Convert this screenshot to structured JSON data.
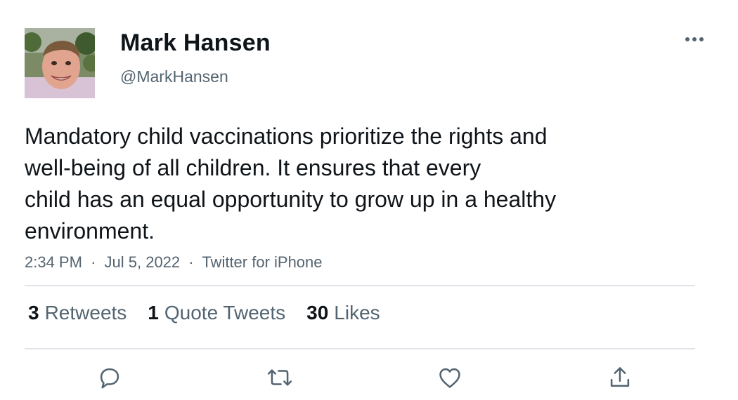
{
  "tweet": {
    "author": {
      "display_name": "Mark Hansen",
      "handle": "@MarkHansen",
      "avatar_icon": "profile-photo"
    },
    "text_lines": [
      "Mandatory child vaccinations prioritize the rights and",
      "well-being of all children. It ensures that every",
      "child has an equal opportunity to grow up in a healthy",
      "environment."
    ],
    "time": "2:34 PM",
    "date": "Jul 5, 2022",
    "source": "Twitter for iPhone",
    "separator": "·",
    "stats": {
      "retweets_count": "3",
      "retweets_label": "Retweets",
      "quotes_count": "1",
      "quotes_label": "Quote Tweets",
      "likes_count": "30",
      "likes_label": "Likes"
    },
    "actions": [
      "reply-icon",
      "retweet-icon",
      "like-icon",
      "share-icon"
    ],
    "more_icon": "more-icon",
    "colors": {
      "text": "#0f1419",
      "secondary": "#536471",
      "divider": "#e1e4e8",
      "icon": "#536471"
    }
  }
}
